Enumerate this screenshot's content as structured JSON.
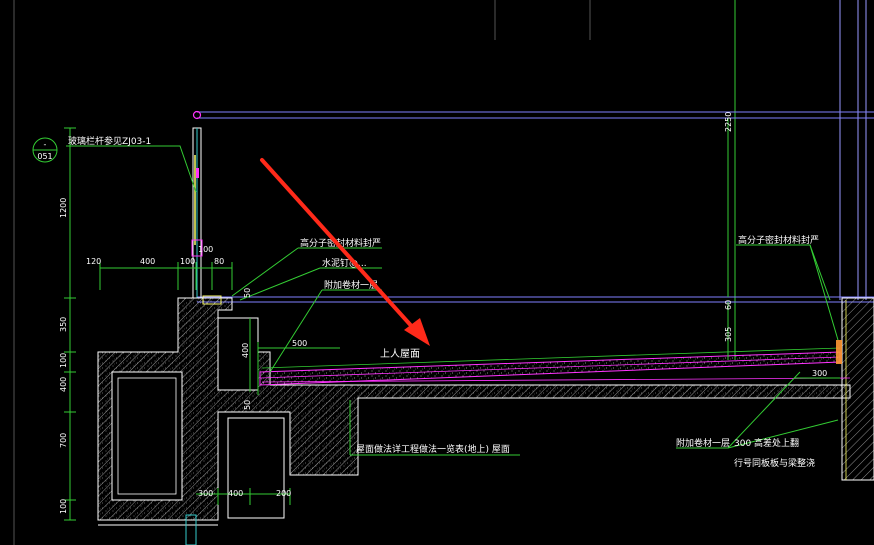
{
  "annotations": {
    "railing_note": "玻璃栏杆参见ZJ03-1",
    "sealant_left": "高分子密封材料封严",
    "mortar_note": "水泥钉@...",
    "extra_membrane_top": "附加卷材一层",
    "roof_label": "上人屋面",
    "roof_method": "屋面做法详工程做法一览表(地上) 屋面",
    "sealant_right": "高分子密封材料封严",
    "extra_membrane_bottom": "附加卷材一层",
    "upturn_note": "300  高差处上翻",
    "upturn_note2": "行号同板板与梁整浇"
  },
  "detail_marker": {
    "top": "-",
    "bottom": "051"
  },
  "dimensions": {
    "h2250": "2250",
    "v1200": "1200",
    "d120": "120",
    "d400a": "400",
    "d100a": "100",
    "d100b": "100",
    "d80": "80",
    "d50a": "50",
    "d350": "350",
    "d100c": "100",
    "d400v": "400",
    "d700": "700",
    "d100d": "100",
    "d400b": "400",
    "d300a": "300",
    "d500": "500",
    "d50b": "50",
    "d400c": "400",
    "d200": "200",
    "d300b": "300",
    "d60": "60",
    "d305": "305",
    "d300c": "300"
  },
  "colors": {
    "background": "#000000",
    "line_blue": "#7f7fff",
    "line_green": "#33cc33",
    "line_magenta": "#ff33ff",
    "line_white": "#ffffff",
    "line_yellow": "#ffff66",
    "line_cyan": "#33cccc",
    "arrow_red": "#ff2a1a"
  }
}
